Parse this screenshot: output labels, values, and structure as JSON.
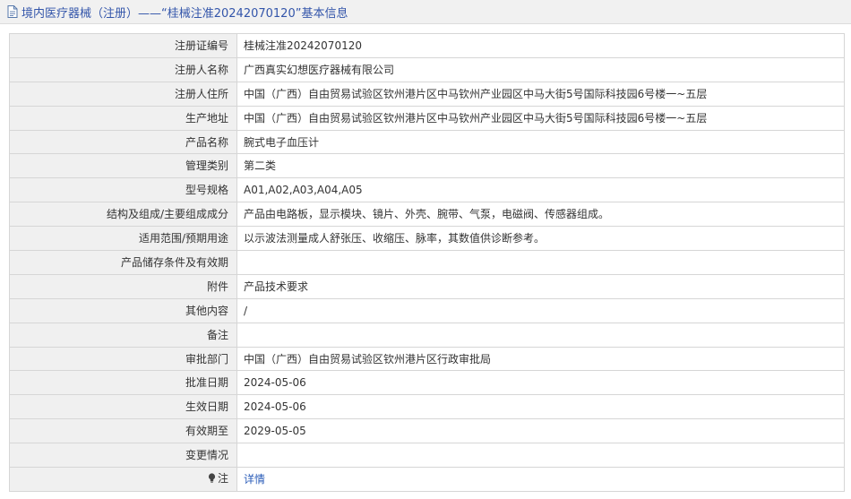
{
  "header": {
    "title": "境内医疗器械（注册）——“桂械注准20242070120”基本信息",
    "icon": "document-icon"
  },
  "rows": [
    {
      "key": "registration-number",
      "label": "注册证编号",
      "value": "桂械注准20242070120"
    },
    {
      "key": "registrant-name",
      "label": "注册人名称",
      "value": "广西真实幻想医疗器械有限公司"
    },
    {
      "key": "registrant-address",
      "label": "注册人住所",
      "value": "中国（广西）自由贸易试验区钦州港片区中马钦州产业园区中马大街5号国际科技园6号楼一~五层"
    },
    {
      "key": "production-address",
      "label": "生产地址",
      "value": "中国（广西）自由贸易试验区钦州港片区中马钦州产业园区中马大街5号国际科技园6号楼一~五层"
    },
    {
      "key": "product-name",
      "label": "产品名称",
      "value": "腕式电子血压计"
    },
    {
      "key": "management-category",
      "label": "管理类别",
      "value": "第二类"
    },
    {
      "key": "model-spec",
      "label": "型号规格",
      "value": "A01,A02,A03,A04,A05"
    },
    {
      "key": "structure-composition",
      "label": "结构及组成/主要组成成分",
      "value": "产品由电路板，显示模块、镜片、外壳、腕带、气泵，电磁阀、传感器组成。"
    },
    {
      "key": "intended-use",
      "label": "适用范围/预期用途",
      "value": "以示波法测量成人舒张压、收缩压、脉率，其数值供诊断参考。"
    },
    {
      "key": "storage-validity",
      "label": "产品储存条件及有效期",
      "value": ""
    },
    {
      "key": "attachment",
      "label": "附件",
      "value": "产品技术要求"
    },
    {
      "key": "other-content",
      "label": "其他内容",
      "value": "/"
    },
    {
      "key": "remarks",
      "label": "备注",
      "value": ""
    },
    {
      "key": "approval-department",
      "label": "审批部门",
      "value": "中国（广西）自由贸易试验区钦州港片区行政审批局"
    },
    {
      "key": "approval-date",
      "label": "批准日期",
      "value": "2024-05-06"
    },
    {
      "key": "effective-date",
      "label": "生效日期",
      "value": "2024-05-06"
    },
    {
      "key": "valid-until",
      "label": "有效期至",
      "value": "2029-05-05"
    },
    {
      "key": "change-status",
      "label": "变更情况",
      "value": ""
    }
  ],
  "note": {
    "label": "注",
    "icon": "lightbulb-icon",
    "link_text": "详情"
  },
  "colors": {
    "header_bg": "#f1f1f1",
    "title": "#3355aa",
    "label_bg": "#f0f0f0",
    "border": "#d6d6d6",
    "link": "#2a5cb8"
  }
}
